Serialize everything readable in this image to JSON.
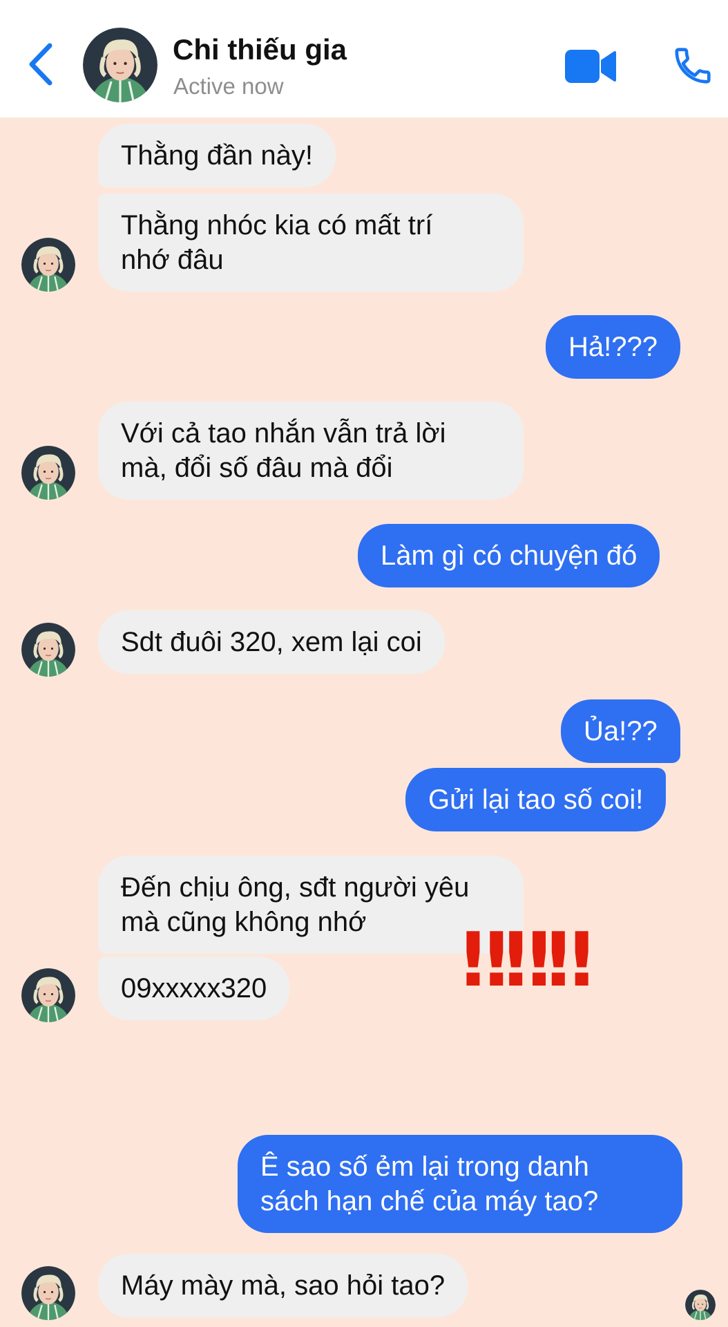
{
  "header": {
    "contact_name": "Chi thiếu gia",
    "status": "Active now"
  },
  "colors": {
    "accent": "#2f6ff2",
    "chat_background": "#fde6d9",
    "incoming_bubble": "#f0efef",
    "emphasis_red": "#e21d0b"
  },
  "icons": [
    "chevron-left-icon",
    "video-camera-icon",
    "phone-icon",
    "double-exclamation-icon"
  ],
  "messages": [
    {
      "from": "contact",
      "text": "Thằng đần này!"
    },
    {
      "from": "contact",
      "line1": "Thằng nhóc kia có mất trí",
      "line2": "nhớ đâu"
    },
    {
      "from": "me",
      "text": "Hả!???"
    },
    {
      "from": "contact",
      "line1": "Với cả tao nhắn vẫn trả lời",
      "line2": "mà, đổi số đâu mà đổi"
    },
    {
      "from": "me",
      "text": "Làm gì có chuyện đó"
    },
    {
      "from": "contact",
      "text": "Sdt đuôi 320, xem lại coi"
    },
    {
      "from": "me",
      "text": "Ủa!??"
    },
    {
      "from": "me",
      "text": "Gửi lại tao số coi!"
    },
    {
      "from": "contact",
      "line1": "Đến chịu ông, sđt người yêu",
      "line2": "mà cũng không nhớ"
    },
    {
      "from": "contact",
      "text": "09xxxxx320"
    },
    {
      "from": "me",
      "emoji": "‼‼‼"
    },
    {
      "from": "me",
      "line1": "Ê sao số ẻm lại trong danh",
      "line2": "sách hạn chế của máy tao?"
    },
    {
      "from": "contact",
      "text": "Máy mày mà, sao hỏi tao?"
    }
  ]
}
